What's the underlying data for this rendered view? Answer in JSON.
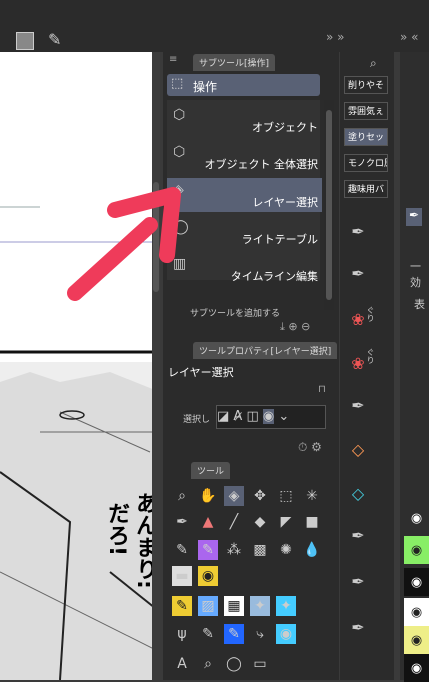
{
  "subtool_panel": {
    "tab_label": "サブツール[操作]",
    "group_label": "操作",
    "items": [
      {
        "label": "オブジェクト"
      },
      {
        "label": "オブジェクト 全体選択"
      },
      {
        "label": "レイヤー選択"
      },
      {
        "label": "ライトテーブル"
      },
      {
        "label": "タイムライン編集"
      }
    ],
    "add_label": "サブツールを追加する"
  },
  "property_panel": {
    "tab_label": "ツールプロパティ[レイヤー選択]",
    "title": "レイヤー選択",
    "select_label": "選択し"
  },
  "tool_panel": {
    "tab_label": "ツール"
  },
  "brush_swatches": [
    "削りやそ",
    "雰囲気ぇ",
    "塗りセット",
    "モノクロ原",
    "趣味用バ"
  ],
  "brush_tags": [
    "ぐり",
    "ぐり"
  ],
  "right_panel": {
    "label1": "一効",
    "label2": "表"
  },
  "manga_text": {
    "line1": "だろ!",
    "line2": "あんまり:"
  },
  "colors": {
    "accent_arrow": "#ef3b5a",
    "selected": "#596175",
    "panel": "#3a3a3a"
  }
}
